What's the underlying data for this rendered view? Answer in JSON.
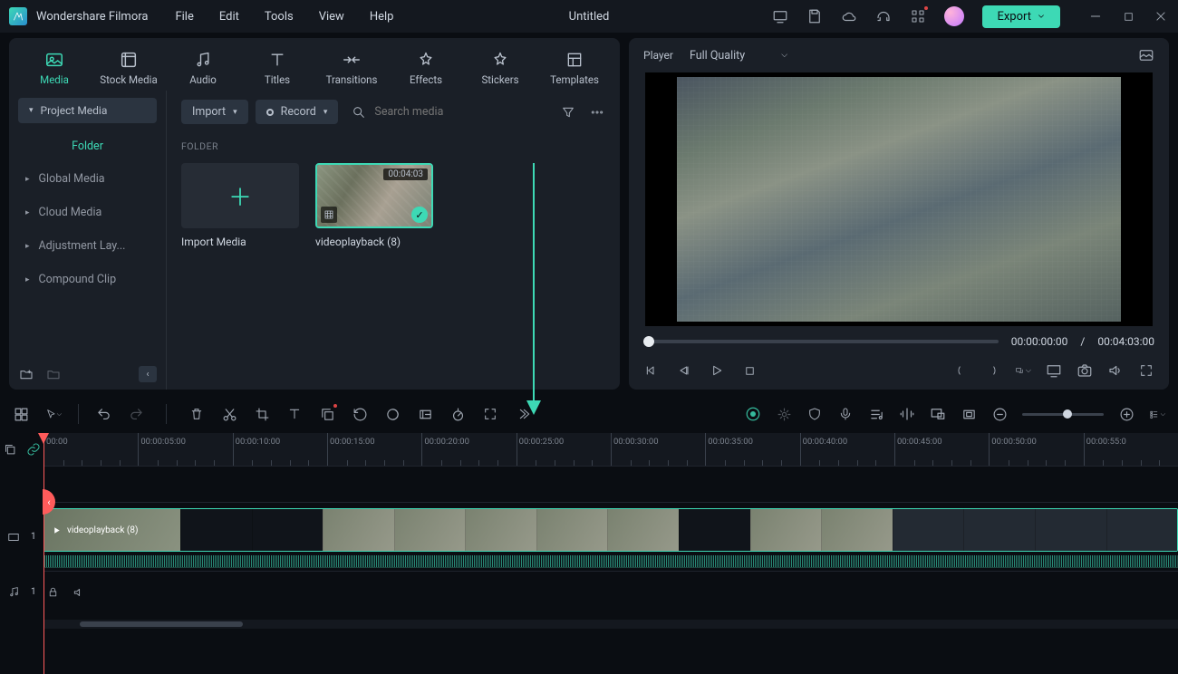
{
  "app_name": "Wondershare Filmora",
  "document_title": "Untitled",
  "menu": [
    "File",
    "Edit",
    "Tools",
    "View",
    "Help"
  ],
  "export_label": "Export",
  "top_tabs": [
    {
      "id": "media",
      "label": "Media",
      "active": true
    },
    {
      "id": "stock",
      "label": "Stock Media"
    },
    {
      "id": "audio",
      "label": "Audio"
    },
    {
      "id": "titles",
      "label": "Titles"
    },
    {
      "id": "transitions",
      "label": "Transitions"
    },
    {
      "id": "effects",
      "label": "Effects"
    },
    {
      "id": "stickers",
      "label": "Stickers"
    },
    {
      "id": "templates",
      "label": "Templates"
    }
  ],
  "sidebar": {
    "project_media": "Project Media",
    "folder_label": "Folder",
    "items": [
      "Global Media",
      "Cloud Media",
      "Adjustment Lay...",
      "Compound Clip"
    ]
  },
  "media_toolbar": {
    "import_label": "Import",
    "record_label": "Record",
    "search_placeholder": "Search media"
  },
  "media_section_label": "FOLDER",
  "import_tile_label": "Import Media",
  "clip": {
    "name": "videoplayback (8)",
    "duration": "00:04:03"
  },
  "player": {
    "tab": "Player",
    "quality": "Full Quality",
    "time_current": "00:00:00:00",
    "time_separator": "/",
    "time_total": "00:04:03:00"
  },
  "ruler_marks": [
    "00:00",
    "00:00:05:00",
    "00:00:10:00",
    "00:00:15:00",
    "00:00:20:00",
    "00:00:25:00",
    "00:00:30:00",
    "00:00:35:00",
    "00:00:40:00",
    "00:00:45:00",
    "00:00:50:00",
    "00:00:55:0"
  ],
  "timeline_clip_label": "videoplayback (8)",
  "track_video_num": "1",
  "track_audio_num": "1"
}
